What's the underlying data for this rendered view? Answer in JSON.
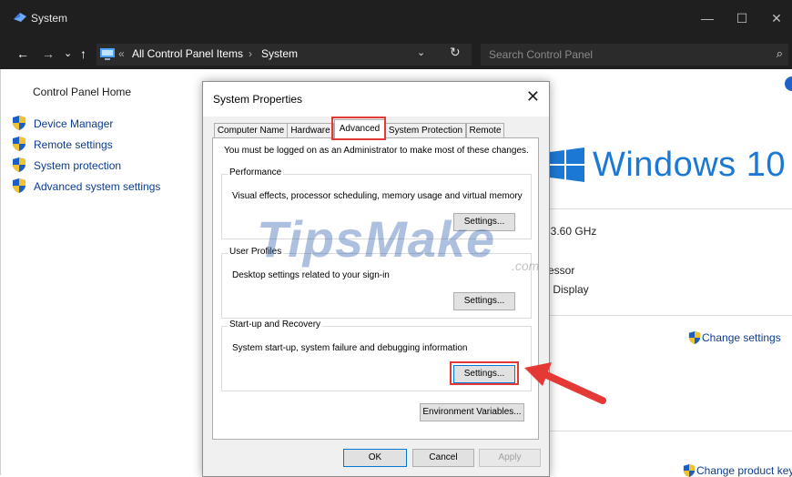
{
  "window": {
    "title": "System",
    "minimize_glyph": "—",
    "maximize_glyph": "☐",
    "close_glyph": "✕"
  },
  "address_bar": {
    "back_glyph": "←",
    "forward_glyph": "→",
    "recent_glyph": "⌄",
    "up_glyph": "↑",
    "overflow": "«",
    "crumbs": [
      "All Control Panel Items",
      "System"
    ],
    "crumb_separator": "›",
    "dropdown_glyph": "⌄",
    "refresh_glyph": "↻",
    "search_placeholder": "Search Control Panel",
    "search_glyph": "⌕"
  },
  "left_pane": {
    "home": "Control Panel Home",
    "links": [
      "Device Manager",
      "Remote settings",
      "System protection",
      "Advanced system settings"
    ]
  },
  "background": {
    "windows_logo_text": "Windows 10",
    "processor_speed": ": 3.60 GHz",
    "processor_suffix": "essor",
    "display_suffix": "s Display",
    "change_settings": "Change settings",
    "change_product_key": "Change product key"
  },
  "dialog": {
    "title": "System Properties",
    "close_glyph": "✕",
    "tabs": [
      "Computer Name",
      "Hardware",
      "Advanced",
      "System Protection",
      "Remote"
    ],
    "active_tab": "Advanced",
    "admin_note": "You must be logged on as an Administrator to make most of these changes.",
    "groups": [
      {
        "title": "Performance",
        "description": "Visual effects, processor scheduling, memory usage and virtual memory",
        "button": "Settings..."
      },
      {
        "title": "User Profiles",
        "description": "Desktop settings related to your sign-in",
        "button": "Settings..."
      },
      {
        "title": "Start-up and Recovery",
        "description": "System start-up, system failure and debugging information",
        "button": "Settings..."
      }
    ],
    "env_button": "Environment Variables...",
    "ok": "OK",
    "cancel": "Cancel",
    "apply": "Apply"
  },
  "watermark": {
    "main": "TipsMake",
    "suffix": ".com"
  },
  "colors": {
    "highlight": "#e53935",
    "accent": "#1b78d4",
    "link": "#0d3b8f",
    "titlebar": "#1f1f1f"
  }
}
